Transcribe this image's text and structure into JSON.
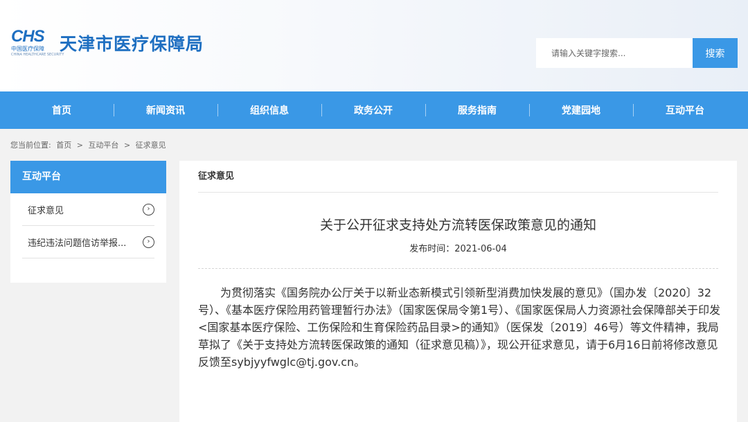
{
  "header": {
    "logo_mark": "CHS",
    "logo_sub": "中国医疗保障",
    "logo_sub2": "CHINA HEALTHCARE SECURITY",
    "site_title": "天津市医疗保障局",
    "search_placeholder": "请输入关键字搜索...",
    "search_button": "搜索"
  },
  "nav": {
    "items": [
      {
        "label": "首页"
      },
      {
        "label": "新闻资讯"
      },
      {
        "label": "组织信息"
      },
      {
        "label": "政务公开"
      },
      {
        "label": "服务指南"
      },
      {
        "label": "党建园地"
      },
      {
        "label": "互动平台"
      }
    ]
  },
  "breadcrumb": {
    "prefix": "您当前位置:",
    "items": [
      "首页",
      ">",
      "互动平台",
      ">",
      "征求意见"
    ]
  },
  "sidebar": {
    "title": "互动平台",
    "items": [
      {
        "label": "征求意见",
        "arrow": "›"
      },
      {
        "label": "违纪违法问题信访举报...",
        "arrow": "›"
      }
    ]
  },
  "main": {
    "section_title": "征求意见",
    "article_title": "关于公开征求支持处方流转医保政策意见的通知",
    "date_label": "发布时间：",
    "date_value": "2021-06-04",
    "body": "为贯彻落实《国务院办公厅关于以新业态新模式引领新型消费加快发展的意见》（国办发〔2020〕32号）、《基本医疗保险用药管理暂行办法》（国家医保局令第1号）、《国家医保局人力资源社会保障部关于印发<国家基本医疗保险、工伤保险和生育保险药品目录>的通知》（医保发〔2019〕46号）等文件精神，我局草拟了《关于支持处方流转医保政策的通知（征求意见稿）》，现公开征求意见，请于6月16日前将修改意见反馈至sybjyyfwglc@tj.gov.cn。"
  },
  "colors": {
    "brand_blue": "#3a98e6",
    "title_blue": "#1e6fc1"
  }
}
